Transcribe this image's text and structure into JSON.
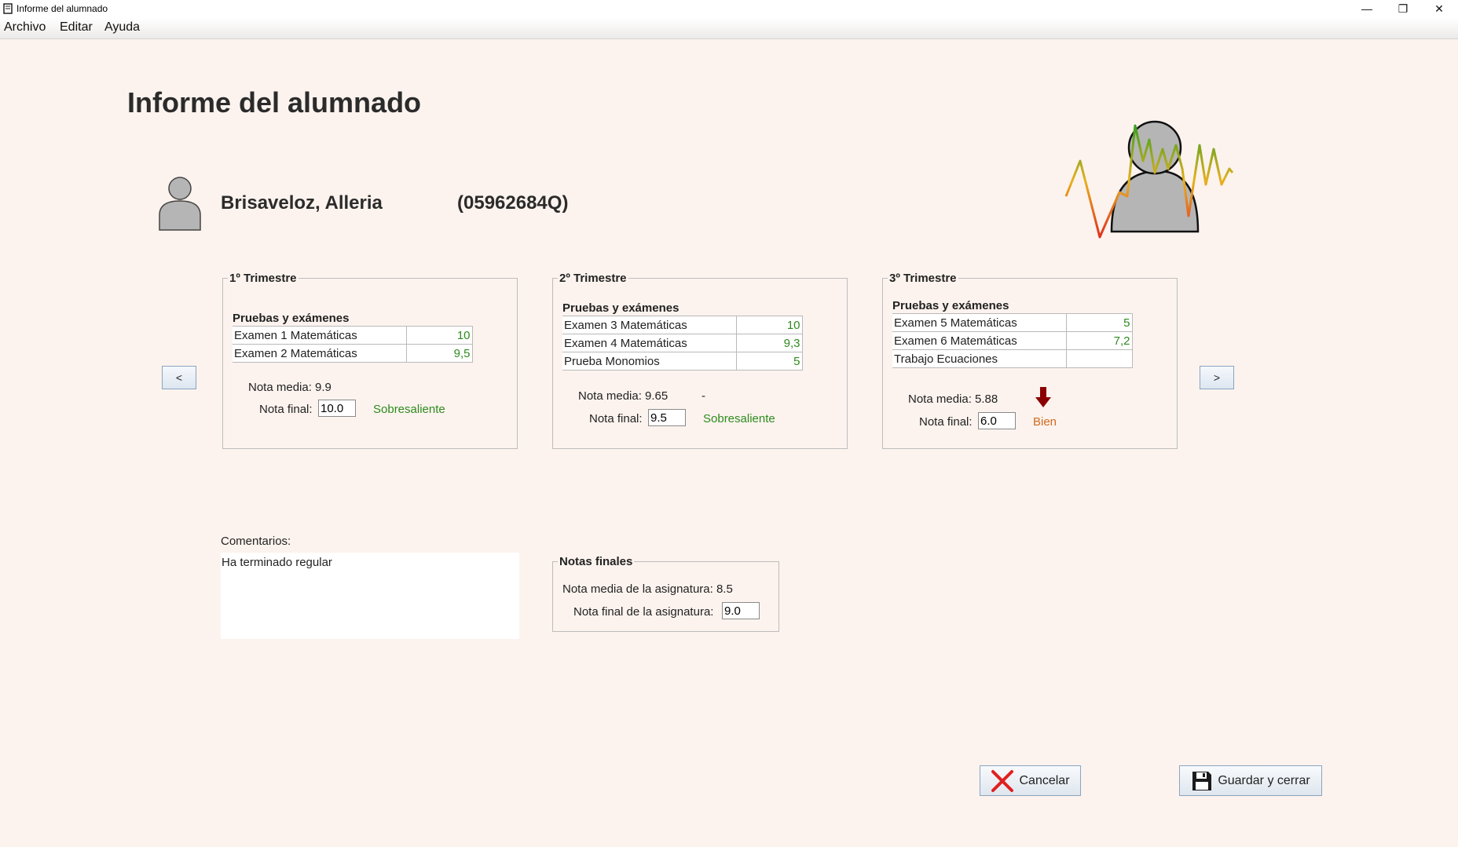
{
  "window": {
    "title": "Informe del alumnado",
    "minimize": "—",
    "restore": "❐",
    "close": "✕"
  },
  "menu": [
    "Archivo",
    "Editar",
    "Ayuda"
  ],
  "page": {
    "title": "Informe del alumnado",
    "student_name": "Brisaveloz, Alleria",
    "student_id": "(05962684Q)"
  },
  "terms": [
    {
      "title": "1º Trimestre",
      "subtitle": "Pruebas y exámenes",
      "rows": [
        {
          "name": "Examen 1 Matemáticas",
          "value": "10"
        },
        {
          "name": "Examen 2 Matemáticas",
          "value": "9,5"
        }
      ],
      "avg_label": "Nota media: 9.9",
      "trend": "",
      "final_label": "Nota final:",
      "final_value": "10.0",
      "grade_word": "Sobresaliente",
      "grade_color": "#2e8b1e"
    },
    {
      "title": "2º Trimestre",
      "subtitle": "Pruebas y exámenes",
      "rows": [
        {
          "name": "Examen 3 Matemáticas",
          "value": "10"
        },
        {
          "name": "Examen 4 Matemáticas",
          "value": "9,3"
        },
        {
          "name": "Prueba Monomios",
          "value": "5"
        }
      ],
      "avg_label": "Nota media: 9.65",
      "trend": "-",
      "final_label": "Nota final:",
      "final_value": "9.5",
      "grade_word": "Sobresaliente",
      "grade_color": "#2e8b1e"
    },
    {
      "title": "3º Trimestre",
      "subtitle": "Pruebas y exámenes",
      "rows": [
        {
          "name": "Examen 5 Matemáticas",
          "value": "5"
        },
        {
          "name": "Examen 6 Matemáticas",
          "value": "7,2"
        },
        {
          "name": "Trabajo Ecuaciones",
          "value": ""
        }
      ],
      "avg_label": "Nota media: 5.88",
      "trend": "down-arrow-icon",
      "final_label": "Nota final:",
      "final_value": "6.0",
      "grade_word": "Bien",
      "grade_color": "#d2691e"
    }
  ],
  "nav": {
    "prev": "<",
    "next": ">"
  },
  "comments": {
    "label": "Comentarios:",
    "text": "Ha terminado regular"
  },
  "final_grades": {
    "title": "Notas finales",
    "avg_label": "Nota media de la asignatura: 8.5",
    "final_label": "Nota final de la asignatura:",
    "final_value": "9.0"
  },
  "buttons": {
    "cancel": "Cancelar",
    "save": "Guardar y cerrar"
  },
  "icons": {
    "avatar": "user-avatar-icon",
    "logo": "student-chart-logo-icon",
    "cancel": "red-x-icon",
    "save": "floppy-disk-icon"
  },
  "colors": {
    "background": "#fcf3ee",
    "grade_green": "#2e8b1e",
    "grade_orange": "#d2691e",
    "trend_down": "#8b0000"
  }
}
